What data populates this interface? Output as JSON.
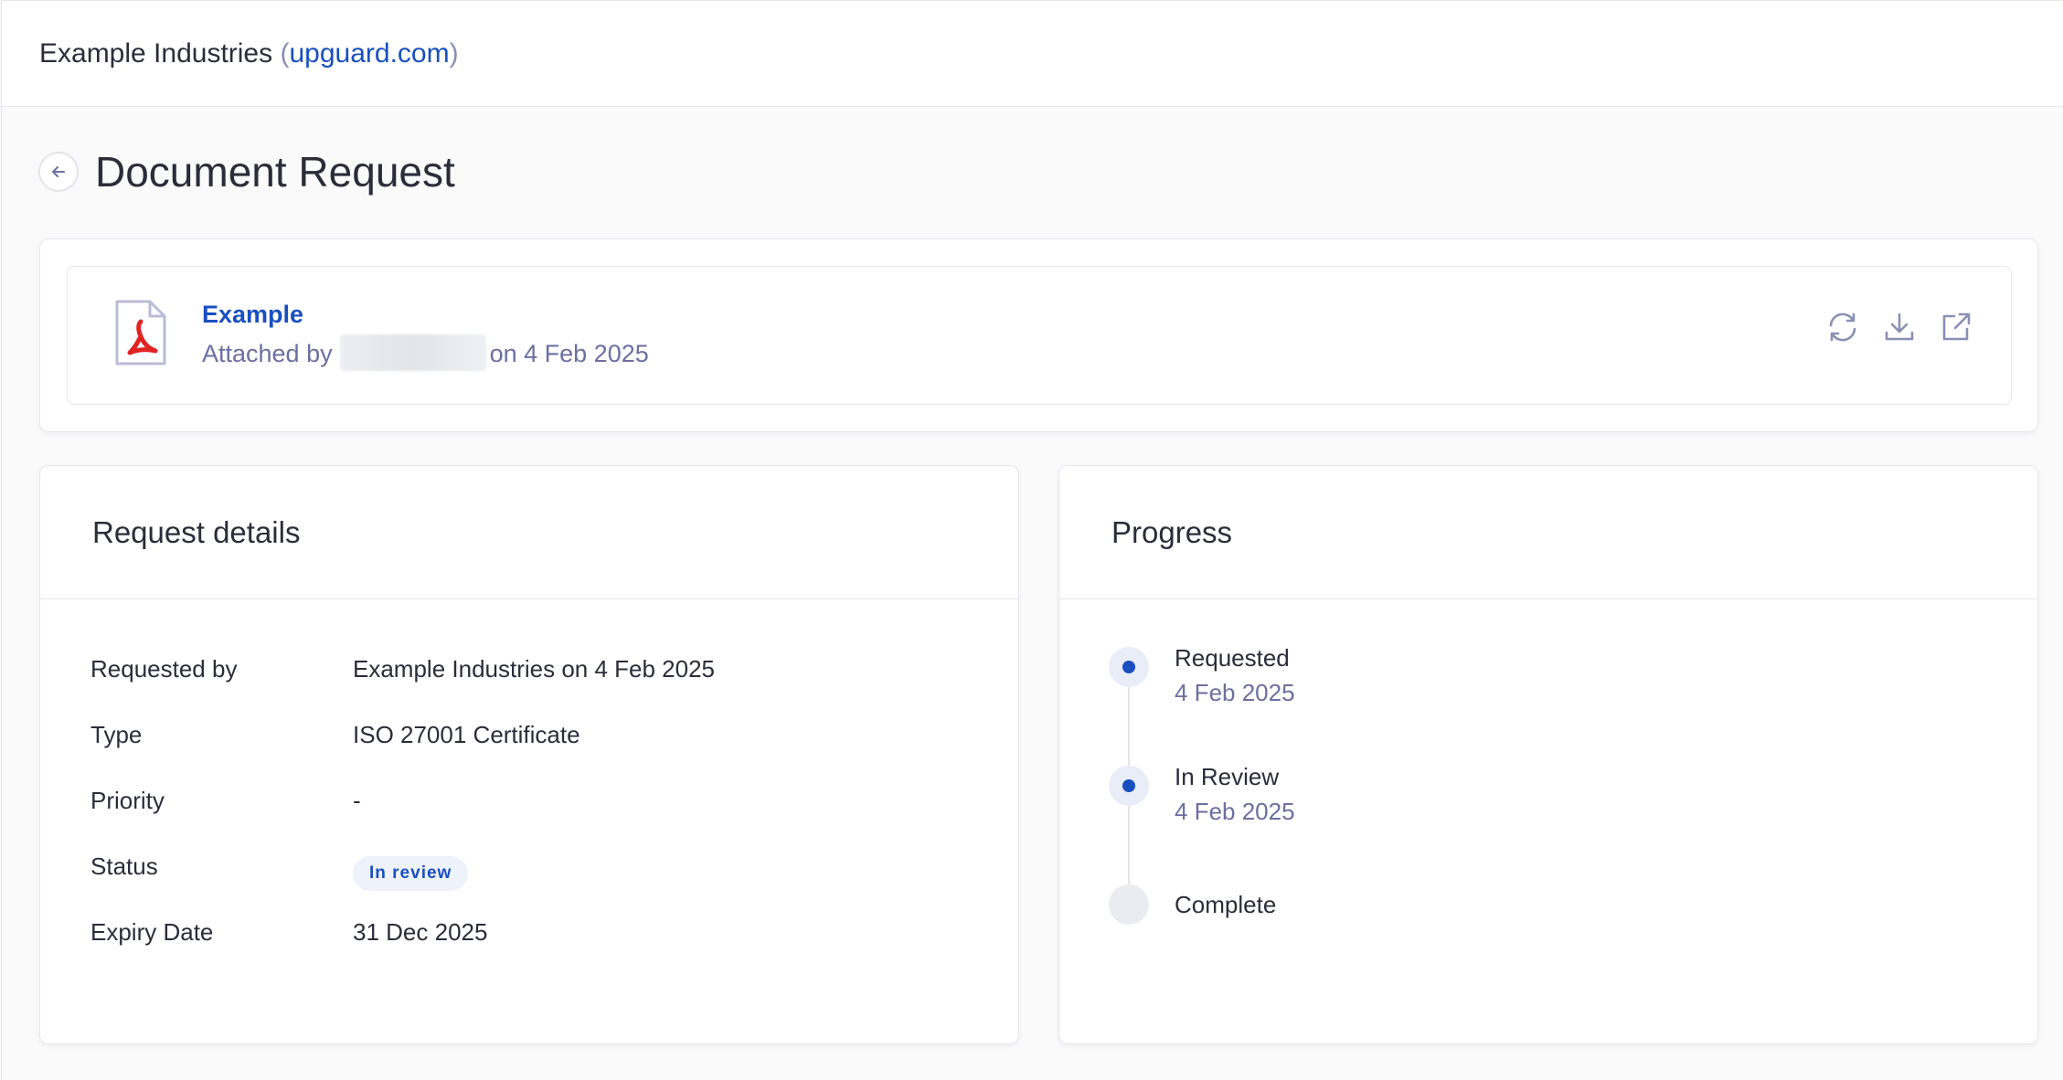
{
  "header": {
    "vendor_name": "Example Industries",
    "vendor_domain": "upguard.com",
    "paren_open": "(",
    "paren_close": ")"
  },
  "page": {
    "title": "Document Request"
  },
  "attachment": {
    "file_name": "Example",
    "attached_by_prefix": "Attached by",
    "attached_on": "on 4 Feb 2025",
    "file_type_icon": "pdf-icon",
    "actions": [
      "refresh-icon",
      "download-icon",
      "external-link-icon"
    ]
  },
  "request_details": {
    "title": "Request details",
    "rows": [
      {
        "label": "Requested by",
        "value": "Example Industries on 4 Feb 2025"
      },
      {
        "label": "Type",
        "value": "ISO 27001 Certificate"
      },
      {
        "label": "Priority",
        "value": "-"
      },
      {
        "label": "Status",
        "value": "In review"
      },
      {
        "label": "Expiry Date",
        "value": "31 Dec 2025"
      }
    ]
  },
  "progress": {
    "title": "Progress",
    "steps": [
      {
        "label": "Requested",
        "date": "4 Feb 2025",
        "state": "done"
      },
      {
        "label": "In Review",
        "date": "4 Feb 2025",
        "state": "done"
      },
      {
        "label": "Complete",
        "date": "",
        "state": "pending"
      }
    ]
  },
  "colors": {
    "accent": "#1a4fbf",
    "muted": "#6b6fa0",
    "pdf_red": "#e02424"
  }
}
